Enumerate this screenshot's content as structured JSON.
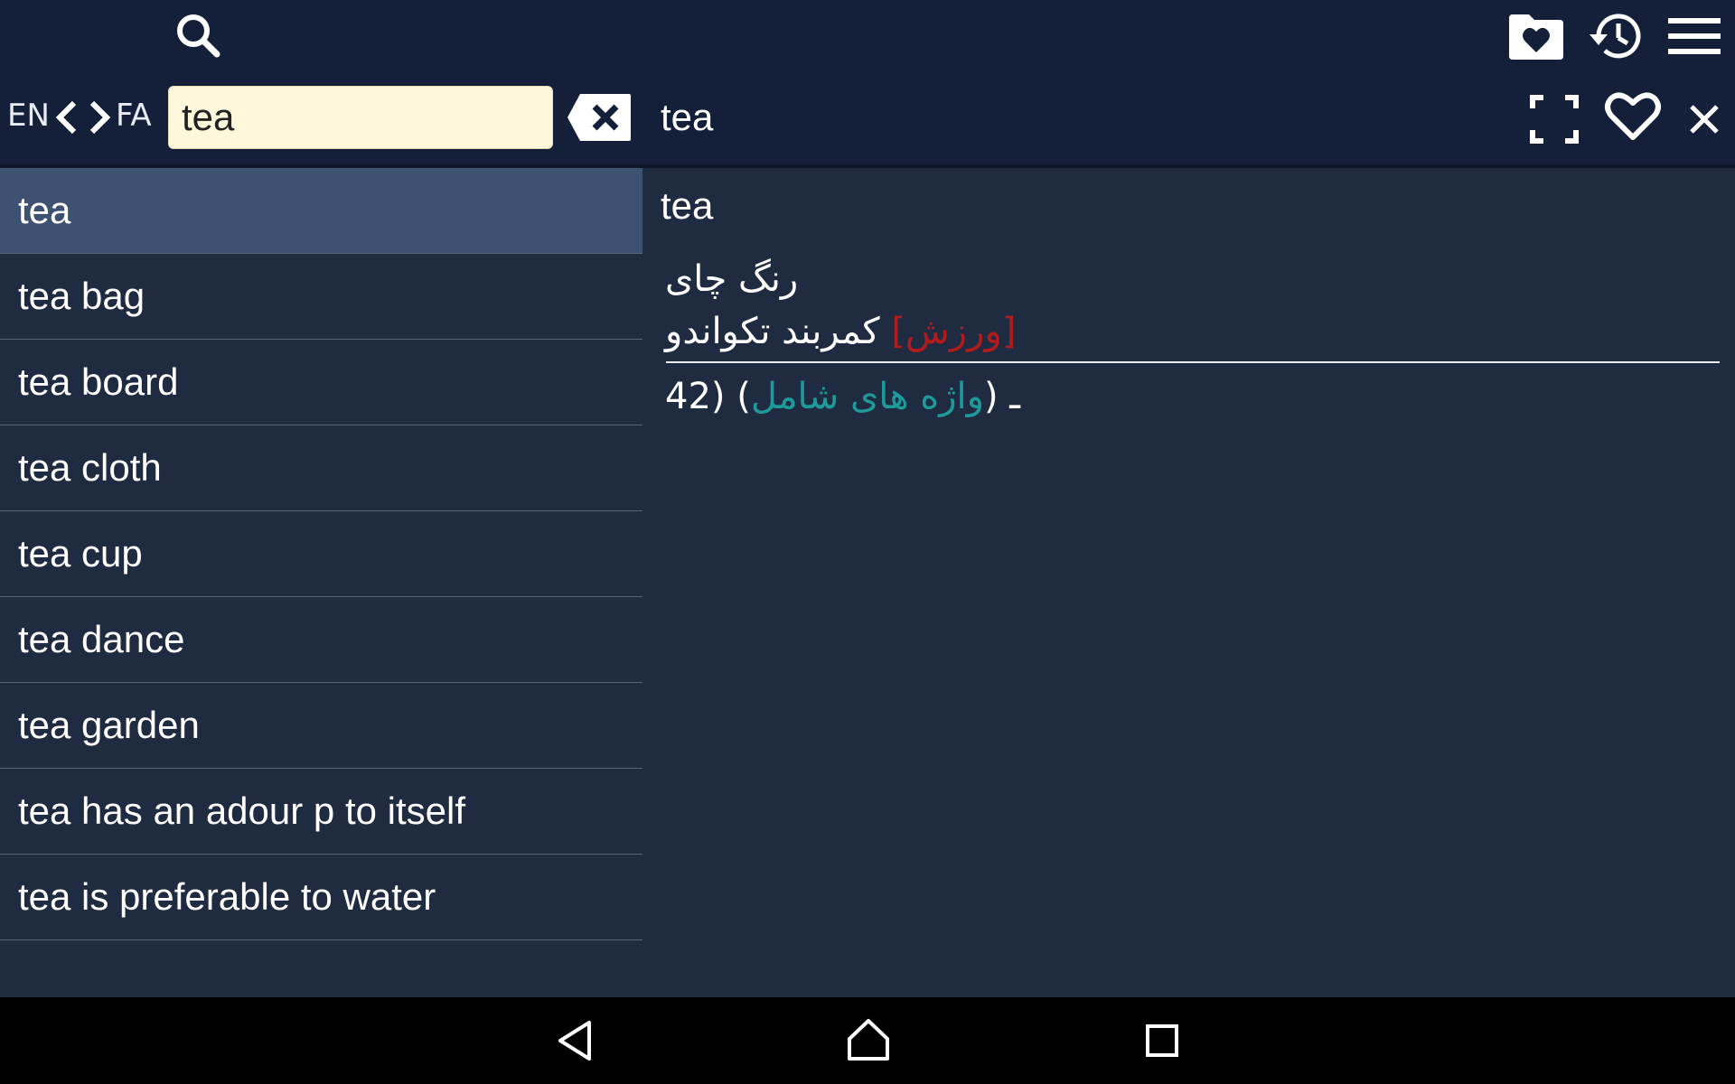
{
  "toolbar": {
    "icons": [
      "search-icon",
      "favorites-folder-icon",
      "history-icon",
      "menu-icon"
    ]
  },
  "search": {
    "lang_from": "EN",
    "lang_to": "FA",
    "query": "tea"
  },
  "entry": {
    "title": "tea"
  },
  "word_list": {
    "items": [
      "tea",
      "tea bag",
      "tea board",
      "tea cloth",
      "tea cup",
      "tea dance",
      "tea garden",
      "tea has an adour p to itself",
      "tea is preferable to water"
    ],
    "selected_index": 0
  },
  "detail": {
    "word": "tea",
    "translation_1": "رنگ چای",
    "translation_2_tag_open": "[ورزش]",
    "translation_2_text": "کمربند تکواندو",
    "related_count": "42) ـ (",
    "related_label": "واژه های شامل",
    "related_close": ")"
  },
  "colors": {
    "toolbar_bg": "#14203a",
    "pane_bg": "#1f2b40",
    "selected_row": "#3d5270",
    "input_bg": "#fdf7dc",
    "tag_red": "#b01c1c",
    "link_teal": "#1f9a9a"
  },
  "navbar": {
    "icons": [
      "back-icon",
      "home-icon",
      "recent-apps-icon"
    ]
  }
}
